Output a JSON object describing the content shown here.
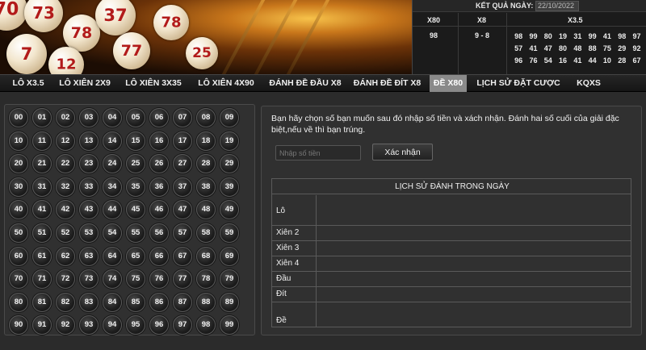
{
  "results": {
    "title": "KẾT QUẢ NGÀY:",
    "date": "22/10/2022",
    "x80_label": "X80",
    "x8_label": "X8",
    "x35_label": "X3.5",
    "x80_value": "98",
    "x8_value": "9 - 8",
    "x35_values": [
      "98",
      "99",
      "80",
      "19",
      "31",
      "99",
      "41",
      "98",
      "97",
      "57",
      "41",
      "47",
      "80",
      "48",
      "88",
      "75",
      "29",
      "92",
      "96",
      "76",
      "54",
      "16",
      "41",
      "44",
      "10",
      "28",
      "67"
    ]
  },
  "banner_balls": [
    "70",
    "73",
    "78",
    "7",
    "12",
    "37",
    "77",
    "78",
    "25"
  ],
  "nav": {
    "items": [
      "LÔ X3.5",
      "LÔ XIÊN 2X9",
      "LÔ XIÊN 3X35",
      "LÔ XIÊN 4X90",
      "ĐÁNH ĐỀ ĐẦU X8",
      "ĐÁNH ĐỀ ĐÍT X8",
      "ĐỀ X80",
      "LỊCH SỬ ĐẶT CƯỢC",
      "KQXS"
    ],
    "active_index": 6
  },
  "numbers": [
    "00",
    "01",
    "02",
    "03",
    "04",
    "05",
    "06",
    "07",
    "08",
    "09",
    "10",
    "11",
    "12",
    "13",
    "14",
    "15",
    "16",
    "17",
    "18",
    "19",
    "20",
    "21",
    "22",
    "23",
    "24",
    "25",
    "26",
    "27",
    "28",
    "29",
    "30",
    "31",
    "32",
    "33",
    "34",
    "35",
    "36",
    "37",
    "38",
    "39",
    "40",
    "41",
    "42",
    "43",
    "44",
    "45",
    "46",
    "47",
    "48",
    "49",
    "50",
    "51",
    "52",
    "53",
    "54",
    "55",
    "56",
    "57",
    "58",
    "59",
    "60",
    "61",
    "62",
    "63",
    "64",
    "65",
    "66",
    "67",
    "68",
    "69",
    "70",
    "71",
    "72",
    "73",
    "74",
    "75",
    "76",
    "77",
    "78",
    "79",
    "80",
    "81",
    "82",
    "83",
    "84",
    "85",
    "86",
    "87",
    "88",
    "89",
    "90",
    "91",
    "92",
    "93",
    "94",
    "95",
    "96",
    "97",
    "98",
    "99"
  ],
  "form": {
    "instructions": "Bạn hãy chọn số bạn muốn sau đó nhập số tiền và xách nhận. Đánh hai số cuối của giải đặc biệt,nếu về thì bạn trúng.",
    "amount_placeholder": "Nhập số tiền",
    "confirm_label": "Xác nhận"
  },
  "history": {
    "title": "LỊCH SỬ ĐÁNH TRONG NGÀY",
    "rows": [
      "Lô",
      "Xiên 2",
      "Xiên 3",
      "Xiên 4",
      "Đầu",
      "Đít",
      "Đề"
    ]
  }
}
